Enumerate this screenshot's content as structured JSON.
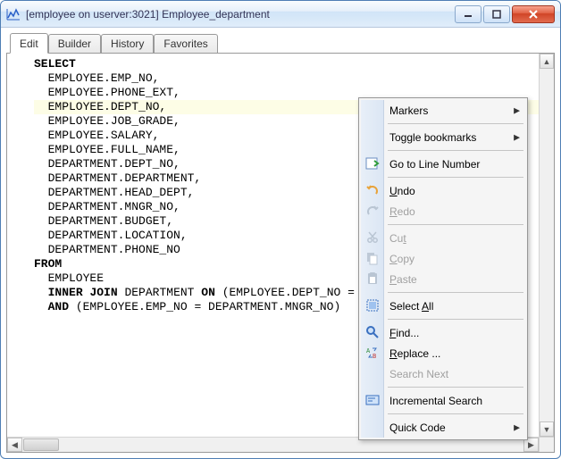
{
  "window": {
    "title": "[employee on userver:3021] Employee_department"
  },
  "tabs": [
    {
      "label": "Edit",
      "active": true
    },
    {
      "label": "Builder",
      "active": false
    },
    {
      "label": "History",
      "active": false
    },
    {
      "label": "Favorites",
      "active": false
    }
  ],
  "sql_keywords": [
    "SELECT",
    "FROM",
    "INNER",
    "JOIN",
    "ON",
    "AND"
  ],
  "sql_lines": [
    {
      "text": "SELECT",
      "indent": 0
    },
    {
      "text": "EMPLOYEE.EMP_NO,",
      "indent": 1
    },
    {
      "text": "EMPLOYEE.PHONE_EXT,",
      "indent": 1
    },
    {
      "text": "EMPLOYEE.DEPT_NO,",
      "indent": 1,
      "highlight": true,
      "caret": true
    },
    {
      "text": "EMPLOYEE.JOB_GRADE,",
      "indent": 1
    },
    {
      "text": "EMPLOYEE.SALARY,",
      "indent": 1
    },
    {
      "text": "EMPLOYEE.FULL_NAME,",
      "indent": 1
    },
    {
      "text": "DEPARTMENT.DEPT_NO,",
      "indent": 1
    },
    {
      "text": "DEPARTMENT.DEPARTMENT,",
      "indent": 1
    },
    {
      "text": "DEPARTMENT.HEAD_DEPT,",
      "indent": 1
    },
    {
      "text": "DEPARTMENT.MNGR_NO,",
      "indent": 1
    },
    {
      "text": "DEPARTMENT.BUDGET,",
      "indent": 1
    },
    {
      "text": "DEPARTMENT.LOCATION,",
      "indent": 1
    },
    {
      "text": "DEPARTMENT.PHONE_NO",
      "indent": 1
    },
    {
      "text": "FROM",
      "indent": 0
    },
    {
      "text": "EMPLOYEE",
      "indent": 1
    },
    {
      "text": "INNER JOIN DEPARTMENT ON (EMPLOYEE.DEPT_NO = DEPARTMENT.DEPT_NO)",
      "indent": 1
    },
    {
      "text": "AND (EMPLOYEE.EMP_NO = DEPARTMENT.MNGR_NO)",
      "indent": 1
    }
  ],
  "context_menu": {
    "items": [
      {
        "type": "item",
        "label": "Markers",
        "submenu": true
      },
      {
        "type": "sep"
      },
      {
        "type": "item",
        "label": "Toggle bookmarks",
        "submenu": true
      },
      {
        "type": "sep"
      },
      {
        "type": "item",
        "label": "Go to Line Number",
        "icon": "goto-icon"
      },
      {
        "type": "sep"
      },
      {
        "type": "item",
        "label": "Undo",
        "accel": "U",
        "icon": "undo-icon"
      },
      {
        "type": "item",
        "label": "Redo",
        "accel": "R",
        "icon": "redo-icon",
        "disabled": true
      },
      {
        "type": "sep"
      },
      {
        "type": "item",
        "label": "Cut",
        "accel": "t",
        "icon": "cut-icon",
        "disabled": true
      },
      {
        "type": "item",
        "label": "Copy",
        "accel": "C",
        "icon": "copy-icon",
        "disabled": true
      },
      {
        "type": "item",
        "label": "Paste",
        "accel": "P",
        "icon": "paste-icon",
        "disabled": true
      },
      {
        "type": "sep"
      },
      {
        "type": "item",
        "label": "Select All",
        "accel": "A",
        "icon": "select-all-icon"
      },
      {
        "type": "sep"
      },
      {
        "type": "item",
        "label": "Find...",
        "accel": "F",
        "icon": "find-icon"
      },
      {
        "type": "item",
        "label": "Replace ...",
        "accel": "R",
        "icon": "replace-icon"
      },
      {
        "type": "item",
        "label": "Search Next",
        "disabled": true
      },
      {
        "type": "sep"
      },
      {
        "type": "item",
        "label": "Incremental Search",
        "icon": "incremental-search-icon"
      },
      {
        "type": "sep"
      },
      {
        "type": "item",
        "label": "Quick Code",
        "submenu": true
      }
    ]
  }
}
